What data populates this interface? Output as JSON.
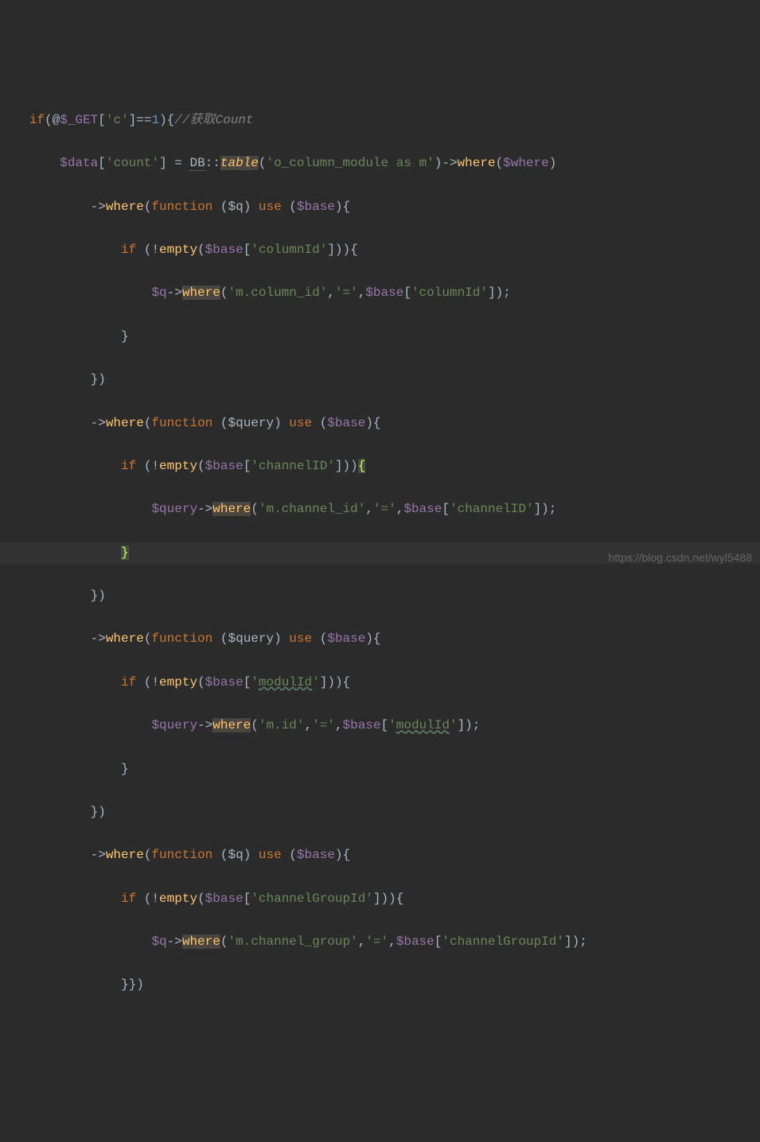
{
  "code": {
    "l1": {
      "if": "if",
      "open": "(@",
      "var": "$_GET",
      "br1": "[",
      "key": "'c'",
      "br2": "]==",
      "num": "1",
      "close": "){",
      "comment": "//获取Count"
    },
    "l2": {
      "var1": "$data",
      "br1": "[",
      "key1": "'count'",
      "br2": "] = ",
      "cls": "DB",
      "dcol": "::",
      "method": "table",
      "p1": "(",
      "arg": "'o_column_module as m'",
      "p2": ")->",
      "where": "where",
      "p3": "(",
      "var2": "$where",
      "p4": ")"
    },
    "l3": {
      "arrow": "->",
      "where": "where",
      "p1": "(",
      "fn": "function ",
      "p2": "(",
      "arg": "$q",
      "p3": ") ",
      "use": "use ",
      "p4": "(",
      "base": "$base",
      "p5": "){"
    },
    "l4": {
      "if": "if ",
      "p1": "(!",
      "empty": "empty",
      "p2": "(",
      "var": "$base",
      "br1": "[",
      "key": "'columnId'",
      "br2": "])){"
    },
    "l5": {
      "var": "$q",
      "arrow": "->",
      "where": "where",
      "p1": "(",
      "s1": "'m.column_id'",
      "c1": ",",
      "s2": "'='",
      "c2": ",",
      "var2": "$base",
      "br1": "[",
      "key": "'columnId'",
      "br2": "]);"
    },
    "l6": {
      "brace": "}"
    },
    "l7": {
      "brace": "})"
    },
    "l8": {
      "arrow": "->",
      "where": "where",
      "p1": "(",
      "fn": "function ",
      "p2": "(",
      "arg": "$query",
      "p3": ") ",
      "use": "use ",
      "p4": "(",
      "base": "$base",
      "p5": "){"
    },
    "l9": {
      "if": "if ",
      "p1": "(!",
      "empty": "empty",
      "p2": "(",
      "var": "$base",
      "br1": "[",
      "key": "'channelID'",
      "br2": "]))",
      "brace": "{"
    },
    "l10": {
      "var": "$query",
      "arrow": "->",
      "where": "where",
      "p1": "(",
      "s1": "'m.channel_id'",
      "c1": ",",
      "s2": "'='",
      "c2": ",",
      "var2": "$base",
      "br1": "[",
      "key": "'channelID'",
      "br2": "]);"
    },
    "l11": {
      "brace": "}"
    },
    "l12": {
      "brace": "})"
    },
    "l13": {
      "arrow": "->",
      "where": "where",
      "p1": "(",
      "fn": "function ",
      "p2": "(",
      "arg": "$query",
      "p3": ") ",
      "use": "use ",
      "p4": "(",
      "base": "$base",
      "p5": "){"
    },
    "l14": {
      "if": "if ",
      "p1": "(!",
      "empty": "empty",
      "p2": "(",
      "var": "$base",
      "br1": "[",
      "key": "'modulId'",
      "br2": "])){"
    },
    "l15": {
      "var": "$query",
      "arrow": "->",
      "where": "where",
      "p1": "(",
      "s1": "'m.id'",
      "c1": ",",
      "s2": "'='",
      "c2": ",",
      "var2": "$base",
      "br1": "[",
      "key": "'modulId'",
      "br2": "]);"
    },
    "l16": {
      "brace": "}"
    },
    "l17": {
      "brace": "})"
    },
    "l18": {
      "arrow": "->",
      "where": "where",
      "p1": "(",
      "fn": "function ",
      "p2": "(",
      "arg": "$q",
      "p3": ") ",
      "use": "use ",
      "p4": "(",
      "base": "$base",
      "p5": "){"
    },
    "l19": {
      "if": "if ",
      "p1": "(!",
      "empty": "empty",
      "p2": "(",
      "var": "$base",
      "br1": "[",
      "key": "'channelGroupId'",
      "br2": "])){"
    },
    "l20": {
      "var": "$q",
      "arrow": "->",
      "where": "where",
      "p1": "(",
      "s1": "'m.channel_group'",
      "c1": ",",
      "s2": "'='",
      "c2": ",",
      "var2": "$base",
      "br1": "[",
      "key": "'channelGroupId'",
      "br2": "]);"
    },
    "l21": {
      "brace": "}})"
    }
  },
  "watermark": "https://blog.csdn.net/wyl5488"
}
